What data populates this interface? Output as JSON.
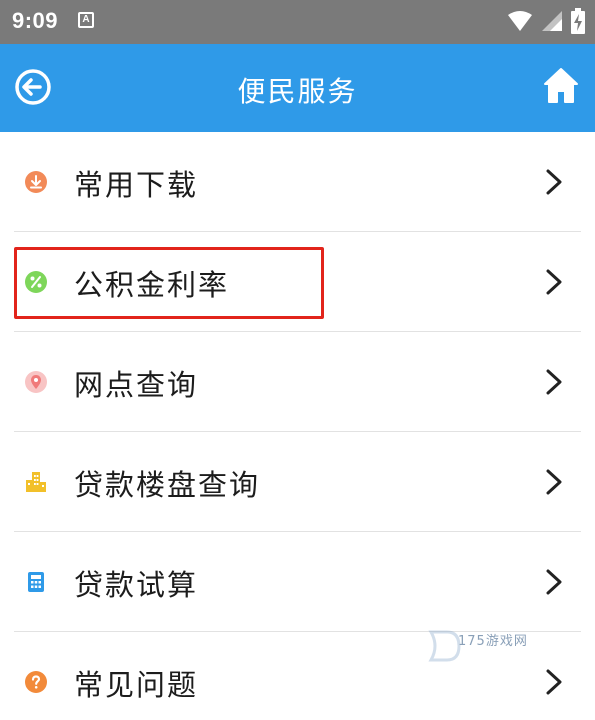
{
  "status_bar": {
    "time": "9:09",
    "notification_letter": "A"
  },
  "app_bar": {
    "title": "便民服务",
    "back_icon": "back-circle-arrow-icon",
    "home_icon": "home-icon"
  },
  "menu": {
    "items": [
      {
        "label": "常用下载",
        "icon": "download-icon",
        "icon_color": "#f28a58"
      },
      {
        "label": "公积金利率",
        "icon": "percent-icon",
        "icon_color": "#7ed65a"
      },
      {
        "label": "网点查询",
        "icon": "location-pin-icon",
        "icon_color": "#f07a7a"
      },
      {
        "label": "贷款楼盘查询",
        "icon": "buildings-icon",
        "icon_color": "#f2c02a"
      },
      {
        "label": "贷款试算",
        "icon": "calculator-icon",
        "icon_color": "#2f9ae8"
      },
      {
        "label": "常见问题",
        "icon": "question-icon",
        "icon_color": "#f28a3a"
      }
    ]
  },
  "watermark": {
    "text": "175游戏网"
  },
  "colors": {
    "app_bar": "#2f9ae8",
    "status_bar": "#7a7a7a",
    "highlight": "#e2241b"
  }
}
